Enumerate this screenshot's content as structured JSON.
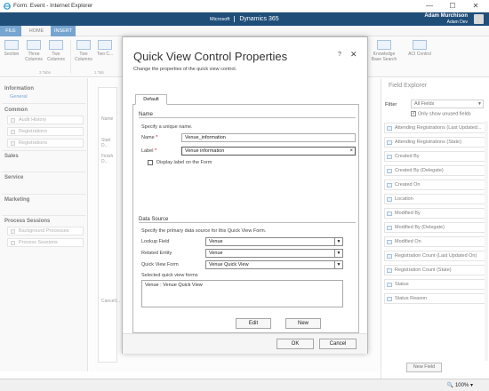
{
  "browser": {
    "title": "Form: Event - Internet Explorer",
    "minimize": "—",
    "maximize": "☐",
    "close": "✕"
  },
  "crm": {
    "brand_small": "Microsoft",
    "app_name": "Dynamics 365",
    "user_name": "Adam Murchison",
    "user_org": "Adam Dev"
  },
  "ribbon": {
    "tabs": [
      "FILE",
      "HOME",
      "INSERT"
    ],
    "buttons": {
      "section": "Section",
      "three_columns": "Three Columns",
      "two_columns_a": "Two Columns",
      "two_columns_b": "Two Columns",
      "two_c": "Two C...",
      "knowledge_base": "Knowledge Base Search",
      "aci_control": "ACI Control"
    },
    "groups": {
      "tabs_group": "3 Tabs",
      "tabs_group2": "1 Tab"
    }
  },
  "leftnav": {
    "information": "Information",
    "general": "General",
    "common": "Common",
    "common_items": [
      "Audit History",
      "Registrations",
      "Registrations"
    ],
    "sales": "Sales",
    "service": "Service",
    "marketing": "Marketing",
    "process_sessions": "Process Sessions",
    "process_items": [
      "Background Processes",
      "Process Sessions"
    ]
  },
  "canvas": {
    "labels": [
      "Name",
      "Start D...",
      "Finish D...",
      "Cancell..."
    ]
  },
  "field_explorer": {
    "title": "Field Explorer",
    "filter_label": "Filter",
    "filter_value": "All Fields",
    "show_unused": "Only show unused fields",
    "fields": [
      "Attending Registrations (Last Updated...",
      "Attending Registrations (State)",
      "Created By",
      "Created By (Delegate)",
      "Created On",
      "Location",
      "Modified By",
      "Modified By (Delegate)",
      "Modified On",
      "Registration Count (Last Updated On)",
      "Registration Count (State)",
      "Status",
      "Status Reason"
    ],
    "new_field": "New Field"
  },
  "statusbar": {
    "zoom": "100%"
  },
  "dialog": {
    "title": "Quick View Control Properties",
    "subtitle": "Change the properties of the quick view control.",
    "help": "?",
    "close": "✕",
    "tab": "Default",
    "name_section": {
      "title": "Name",
      "instruction": "Specify a unique name.",
      "name_label": "Name",
      "name_value": "Venue_information",
      "label_label": "Label",
      "label_value": "Venue information",
      "display_label": "Display label on the Form"
    },
    "data_source": {
      "title": "Data Source",
      "instruction": "Specify the primary data source for this Quick View Form.",
      "lookup_label": "Lookup Field",
      "lookup_value": "Venue",
      "related_label": "Related Entity",
      "related_value": "Venue",
      "qvf_label": "Quick View Form",
      "qvf_value": "Venue Quick View",
      "selected_label": "Selected quick view forms",
      "selected_items": [
        "Venue : Venue Quick View"
      ],
      "edit": "Edit",
      "new": "New"
    },
    "ok": "OK",
    "cancel": "Cancel"
  }
}
